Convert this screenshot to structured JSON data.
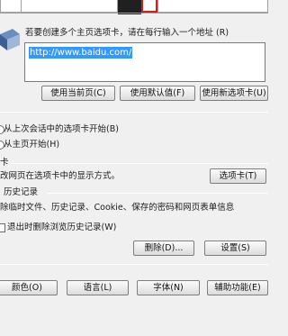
{
  "home_page": {
    "prompt": "若要创建多个主页选项卡，请在每行输入一个地址 (R)",
    "url": "http://www.baidu.com/",
    "btn_current": "使用当前页(C)",
    "btn_default": "使用默认值(F)",
    "btn_new_tab": "使用新选项卡(U)"
  },
  "startup": {
    "option_last_session": "从上次会话中的选项卡开始(B)",
    "option_home": "从主页开始(H)"
  },
  "tabs": {
    "heading": "卡",
    "description": "改网页在选项卡中的显示方式。",
    "btn_tabs": "选项卡(T)"
  },
  "history": {
    "heading": "历史记录",
    "description": "除临时文件、历史记录、Cookie、保存的密码和网页表单信息",
    "checkbox_label": "退出时删除浏览历史记录(W)",
    "btn_delete": "删除(D)...",
    "btn_settings": "设置(S)"
  },
  "appearance": {
    "btn_colors": "颜色(O)",
    "btn_languages": "语言(L)",
    "btn_fonts": "字体(N)",
    "btn_accessibility": "辅助功能(E)"
  }
}
